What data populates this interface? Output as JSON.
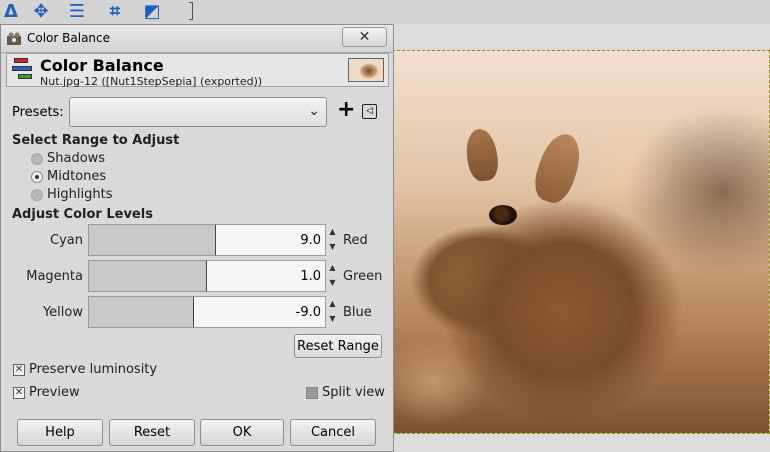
{
  "dialog": {
    "window_title": "Color Balance",
    "close_label": "✕",
    "heading": "Color Balance",
    "subheading": "Nut.jpg-12 ([Nut1StepSepia] (exported))"
  },
  "presets": {
    "label": "Presets:",
    "selected_value": "",
    "add_label": "+",
    "menu_label": "◁"
  },
  "range": {
    "title": "Select Range to Adjust",
    "options": [
      {
        "label": "Shadows",
        "checked": false
      },
      {
        "label": "Midtones",
        "checked": true
      },
      {
        "label": "Highlights",
        "checked": false
      }
    ]
  },
  "levels": {
    "title": "Adjust Color Levels",
    "sliders": [
      {
        "left": "Cyan",
        "right": "Red",
        "value": "9.0",
        "fraction": 0.538
      },
      {
        "left": "Magenta",
        "right": "Green",
        "value": "1.0",
        "fraction": 0.5
      },
      {
        "left": "Yellow",
        "right": "Blue",
        "value": "-9.0",
        "fraction": 0.447
      }
    ],
    "reset_range_label": "Reset Range"
  },
  "options": {
    "preserve_luminosity": {
      "label": "Preserve luminosity",
      "checked": true
    },
    "preview": {
      "label": "Preview",
      "checked": true
    },
    "split_view": {
      "label": "Split view",
      "checked": false
    }
  },
  "footer": {
    "help": "Help",
    "reset": "Reset",
    "ok": "OK",
    "cancel": "Cancel"
  },
  "toolbar": {
    "icons": [
      "path-tool-icon",
      "move-tool-icon",
      "align-tool-icon",
      "crop-tool-icon",
      "transform-tool-icon"
    ]
  },
  "colors": {
    "accent_blue": "#1f5fbf",
    "sepia_mid": "#8b5a33"
  }
}
